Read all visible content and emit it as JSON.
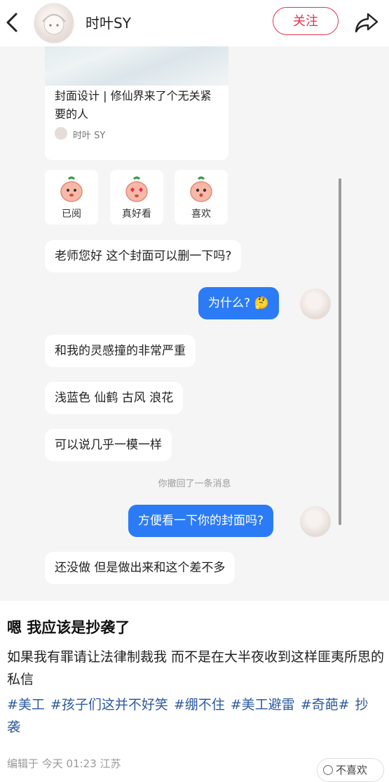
{
  "header": {
    "username": "时叶SY",
    "follow_label": "关注"
  },
  "chat": {
    "post_card": {
      "title": "封面设计 | 修仙界来了个无关紧要的人",
      "author": "时叶 SY"
    },
    "reactions": [
      {
        "label": "已阅",
        "icon": "blob-face-icon"
      },
      {
        "label": "真好看",
        "icon": "heart-eyes-blob-icon"
      },
      {
        "label": "喜欢",
        "icon": "blob-face-icon"
      }
    ],
    "messages": [
      {
        "side": "received",
        "text": "老师您好 这个封面可以删一下吗?"
      },
      {
        "side": "sent",
        "text": "为什么?",
        "emoji": "🤔"
      },
      {
        "side": "received",
        "text": "和我的灵感撞的非常严重"
      },
      {
        "side": "received",
        "text": "浅蓝色 仙鹤 古风 浪花"
      },
      {
        "side": "received",
        "text": "可以说几乎一模一样"
      },
      {
        "side": "system",
        "text": "你撤回了一条消息"
      },
      {
        "side": "sent",
        "text": "方便看一下你的封面吗?"
      },
      {
        "side": "received",
        "text": "还没做 但是做出来和这个差不多"
      }
    ]
  },
  "post": {
    "heading": "嗯 我应该是抄袭了",
    "body": "如果我有罪请让法律制裁我 而不是在大半夜收到这样匪夷所思的私信",
    "tags": [
      "#美工",
      "#孩子们这并不好笑",
      "#绷不住",
      "#美工避雷",
      "#奇葩#",
      "抄袭"
    ],
    "meta": "编辑于 今天 01:23 江苏",
    "dislike_label": "不喜欢"
  },
  "colors": {
    "accent_red": "#e0354e",
    "sent_bubble": "#2b7bf6",
    "tag_blue": "#2c5aa0"
  }
}
